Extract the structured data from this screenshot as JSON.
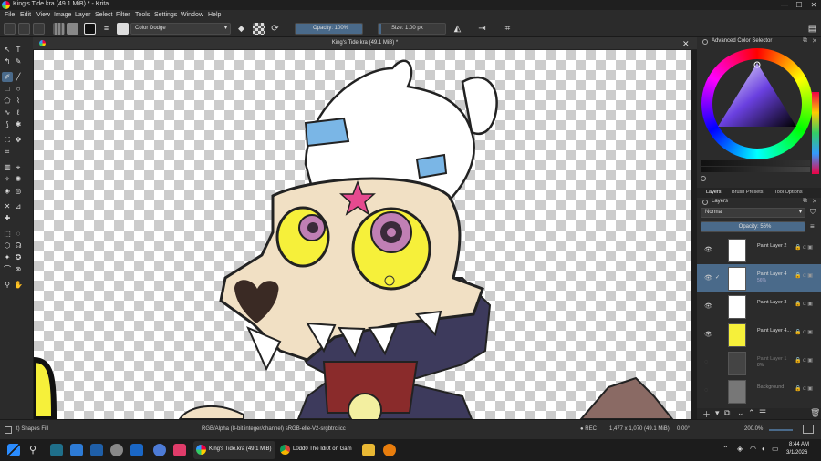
{
  "window": {
    "title": "King's Tide.kra (49.1 MiB) * - Krita",
    "minimize": "—",
    "maximize": "☐",
    "close": "✕"
  },
  "menu": [
    "File",
    "Edit",
    "View",
    "Image",
    "Layer",
    "Select",
    "Filter",
    "Tools",
    "Settings",
    "Window",
    "Help"
  ],
  "toolbar": {
    "blend_mode": "Color Dodge",
    "opacity": "Opacity: 100%",
    "size": "Size: 1.00 px"
  },
  "document": {
    "tab_title": "King's Tide.kra (49.1 MiB) *"
  },
  "color_panel": {
    "title": "Advanced Color Selector"
  },
  "dock_tabs": [
    "Layers",
    "Brush Presets",
    "Tool Options"
  ],
  "layers_panel": {
    "title": "Layers",
    "blend_mode": "Normal",
    "opacity": "Opacity: 56%",
    "layers": [
      {
        "name": "Paint Layer 2",
        "sub": "",
        "visible": true,
        "selected": false,
        "dim": false
      },
      {
        "name": "Paint Layer 4",
        "sub": "56%",
        "visible": true,
        "selected": true,
        "dim": false
      },
      {
        "name": "Paint Layer 3",
        "sub": "",
        "visible": true,
        "selected": false,
        "dim": false
      },
      {
        "name": "Paint Layer 4...",
        "sub": "",
        "visible": true,
        "selected": false,
        "dim": false
      },
      {
        "name": "Paint Layer 1",
        "sub": "8%",
        "visible": false,
        "selected": false,
        "dim": true
      },
      {
        "name": "Background",
        "sub": "",
        "visible": false,
        "selected": false,
        "dim": true
      }
    ]
  },
  "status": {
    "tool": "t) Shapes Fill",
    "color_model": "RGB/Alpha (8-bit integer/channel)  sRGB-elle-V2-srgbtrc.icc",
    "rec": "REC",
    "dimensions": "1,477 x 1,070 (49.1 MiB)",
    "rotation": "0.00°",
    "zoom": "200.0%"
  },
  "taskbar": {
    "krita_window": "King's Tide.kra (49.1 MiB)",
    "chrome_window": "L0dd0 The Idi0t on Gam",
    "time": "8:44 AM",
    "date": "3/1/2026"
  },
  "colors": {
    "chrome_bg": "#2b2b2b",
    "accent_blue": "#4a6a8a",
    "taskbar_bg": "#1c1c1c"
  }
}
